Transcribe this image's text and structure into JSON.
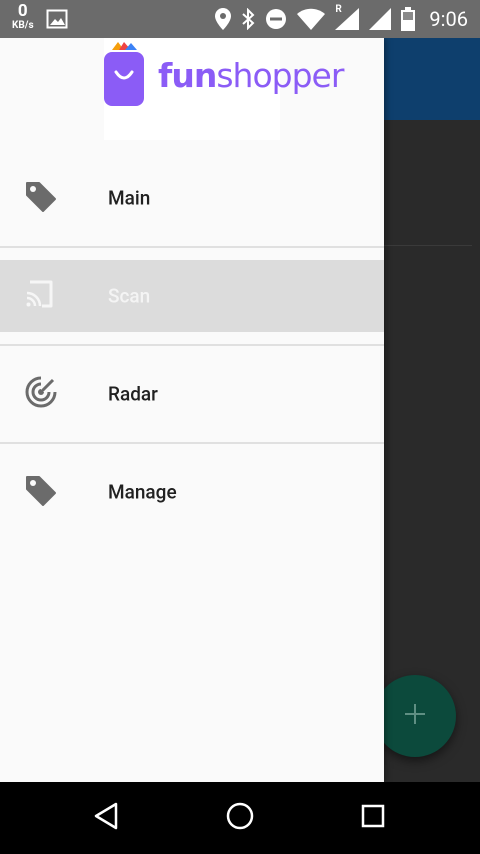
{
  "status_bar": {
    "net_speed_value": "0",
    "net_speed_unit": "KB/s",
    "time": "9:06",
    "roaming_indicator": "R",
    "icons": [
      "image-notification-icon",
      "location-icon",
      "bluetooth-icon",
      "do-not-disturb-icon",
      "wifi-icon",
      "cellular-signal-icon",
      "signal-icon",
      "battery-icon"
    ]
  },
  "drawer": {
    "brand_text": "funshopper",
    "items": [
      {
        "label": "Main",
        "icon": "tag-icon",
        "selected": false
      },
      {
        "label": "Scan",
        "icon": "cast-icon",
        "selected": true
      },
      {
        "label": "Radar",
        "icon": "radar-icon",
        "selected": false
      },
      {
        "label": "Manage",
        "icon": "tag-icon",
        "selected": false
      }
    ]
  },
  "colors": {
    "brand_purple": "#8b5cf6",
    "toolbar_blue": "#0e3f6d",
    "fab_green": "#0c4a3c",
    "selected_item_bg": "#dcdcdc"
  },
  "fab": {
    "icon": "plus-icon"
  },
  "nav_bar": {
    "buttons": [
      "back-icon",
      "home-icon",
      "recents-icon"
    ]
  }
}
